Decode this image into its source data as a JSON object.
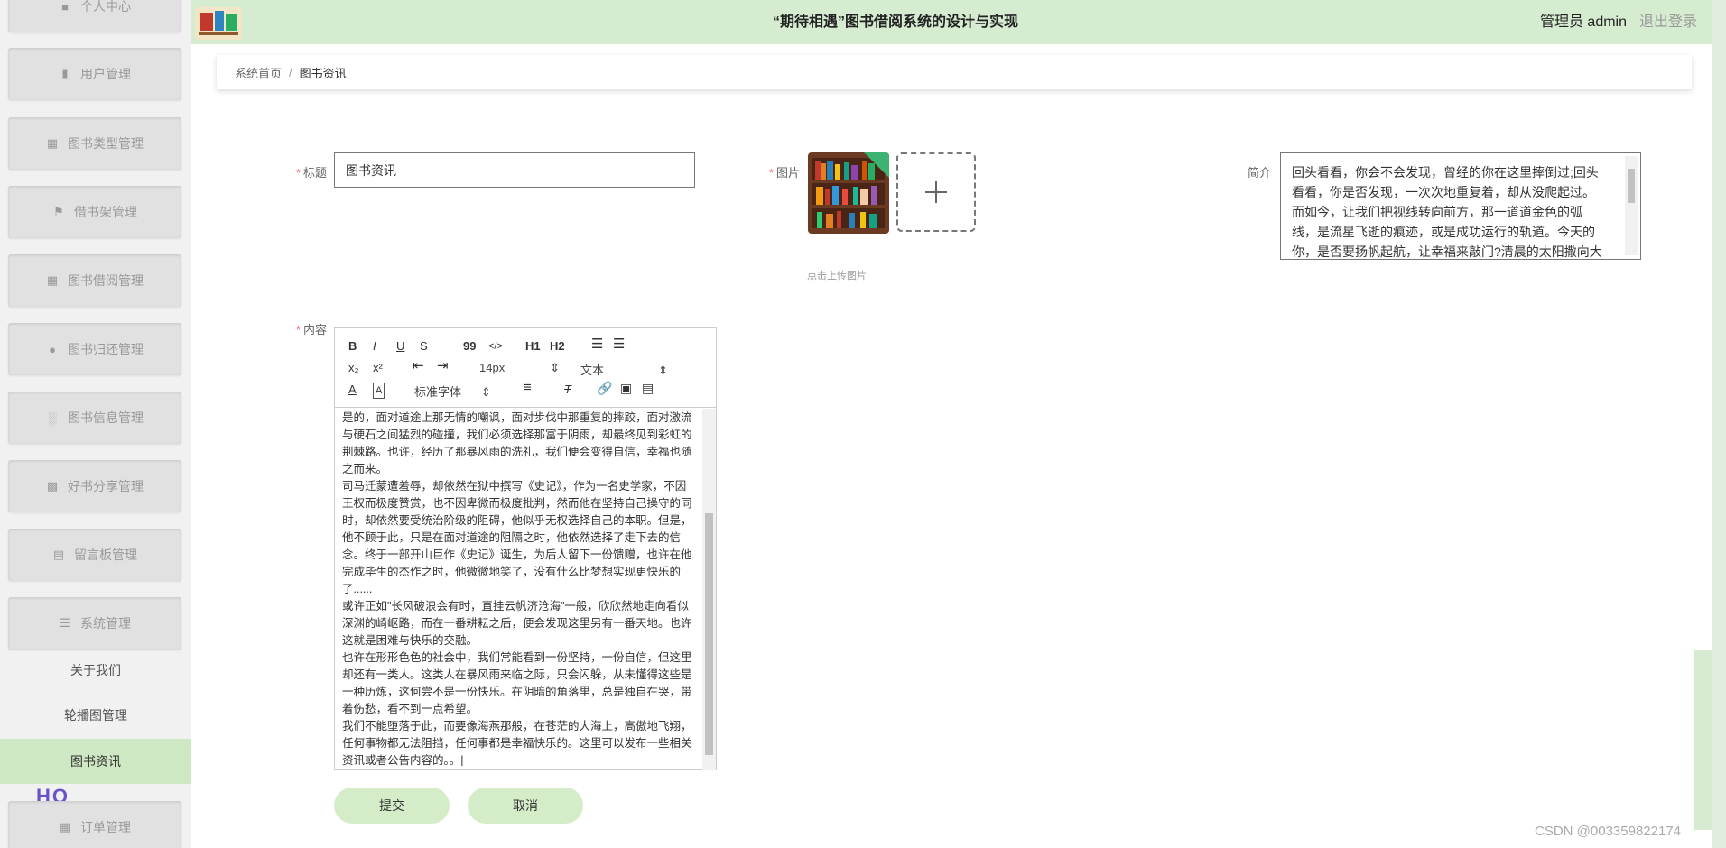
{
  "header": {
    "title": "“期待相遇”图书借阅系统的设计与实现",
    "user": "管理员 admin",
    "logout": "退出登录"
  },
  "sidebar": {
    "top_partial": "个人中心",
    "items": [
      {
        "label": "用户管理",
        "icon": "user-icon"
      },
      {
        "label": "图书类型管理",
        "icon": "grid-icon"
      },
      {
        "label": "借书架管理",
        "icon": "flag-icon"
      },
      {
        "label": "图书借阅管理",
        "icon": "grid-icon"
      },
      {
        "label": "图书归还管理",
        "icon": "bulb-icon"
      },
      {
        "label": "图书信息管理",
        "icon": "bar-chart-icon"
      },
      {
        "label": "好书分享管理",
        "icon": "clipboard-icon"
      },
      {
        "label": "留言板管理",
        "icon": "document-icon"
      },
      {
        "label": "系统管理",
        "icon": "menu-icon"
      }
    ],
    "sub_items": [
      "关于我们",
      "轮播图管理",
      "图书资讯"
    ],
    "active_sub": "图书资讯",
    "bottom_partial": "订单管理"
  },
  "breadcrumb": {
    "home": "系统首页",
    "separator": "/",
    "current": "图书资讯"
  },
  "form": {
    "title_label": "标题",
    "title_value": "图书资讯",
    "image_label": "图片",
    "upload_hint": "点击上传图片",
    "intro_label": "简介",
    "intro_value": "回头看看，你会不会发现，曾经的你在这里摔倒过;回头看看，你是否发现，一次次地重复着，却从没爬起过。而如今，让我们把视线转向前方，那一道道金色的弧线，是流星飞逝的痕迹，或是成功运行的轨道。今天的你，是否要扬帆起航，让幸福来敲门?清晨的太阳撒向大地，神奇",
    "content_label": "内容",
    "submit": "提交",
    "cancel": "取消"
  },
  "editor": {
    "toolbar": {
      "bold": "B",
      "italic": "I",
      "underline": "U",
      "strike": "S",
      "quote": "99",
      "code": "</>",
      "h1": "H1",
      "h2": "H2",
      "sub": "x₂",
      "sup": "x²",
      "size": "14px",
      "block": "文本",
      "font": "标准字体"
    },
    "paragraphs": [
      "是的，面对道途上那无情的嘲讽，面对步伐中那重复的摔跤，面对激流与硬石之间猛烈的碰撞，我们必须选择那富于阴雨，却最终见到彩虹的荆棘路。也许，经历了那暴风雨的洗礼，我们便会变得自信，幸福也随之而来。",
      "司马迁蒙遭羞辱，却依然在狱中撰写《史记》，作为一名史学家，不因王权而极度赞赏，也不因卑微而极度批判，然而他在坚持自己操守的同时，却依然要受统治阶级的阻碍，他似乎无权选择自己的本职。但是，他不顾于此，只是在面对道途的阻隔之时，他依然选择了走下去的信念。终于一部开山巨作《史记》诞生，为后人留下一份馈赠，也许在他完成毕生的杰作之时，他微微地笑了，没有什么比梦想实现更快乐的了......",
      "或许正如\"长风破浪会有时，直挂云帆济沧海\"一般，欣欣然地走向看似深渊的崎岖路，而在一番耕耘之后，便会发现这里另有一番天地。也许这就是困难与快乐的交融。",
      "也许在形形色色的社会中，我们常能看到一份坚持，一份自信，但这里却还有一类人。这类人在暴风雨来临之际，只会闪躲，从未懂得这些是一种历炼，这何尝不是一份快乐。在阴暗的角落里，总是独自在哭，带着伤愁，看不到一点希望。",
      "我们不能堕落于此，而要像海燕那般，在苍茫的大海上，高傲地飞翔，任何事物都无法阻挡，任何事都是幸福快乐的。这里可以发布一些相关资讯或者公告内容的。。|"
    ]
  },
  "watermark": "CSDN @003359822174",
  "deco_text": "HQ",
  "colors": {
    "header_bg": "#d6ecd0",
    "active_bg": "#cfe8c4",
    "button_bg": "#d5ecc9",
    "required": "#f56c6c"
  }
}
